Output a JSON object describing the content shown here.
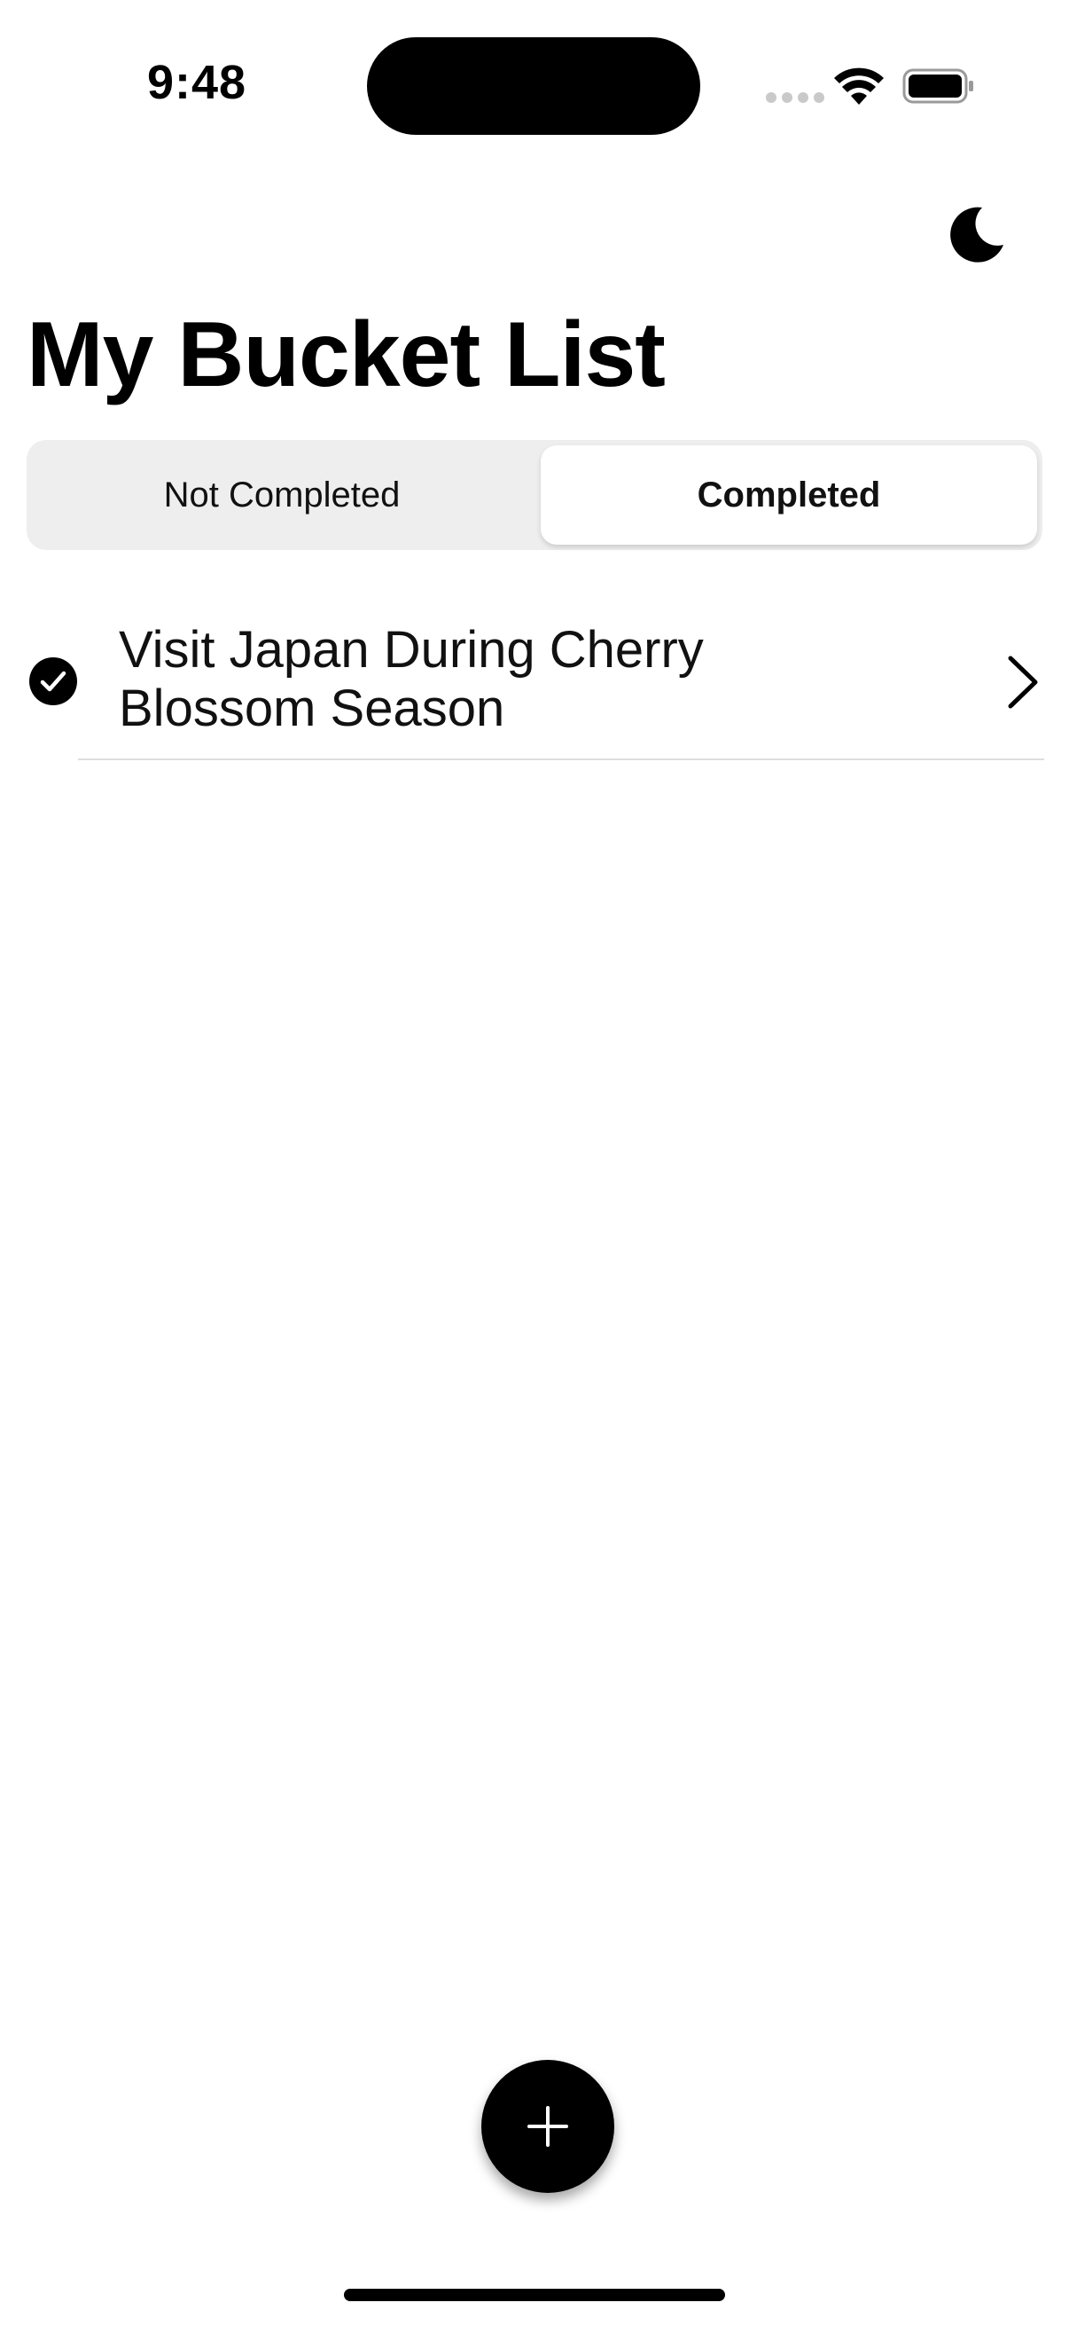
{
  "status_bar": {
    "time": "9:48"
  },
  "header": {
    "title": "My Bucket List",
    "theme_toggle_icon": "moon-icon"
  },
  "tabs": [
    {
      "label": "Not Completed",
      "selected": false
    },
    {
      "label": "Completed",
      "selected": true
    }
  ],
  "items": [
    {
      "title": "Visit Japan During Cherry Blossom Season",
      "completed": true
    }
  ],
  "fab": {
    "icon": "plus-icon"
  },
  "colors": {
    "accent": "#000000",
    "segment_bg": "#eeeeee",
    "divider": "#dedede"
  }
}
